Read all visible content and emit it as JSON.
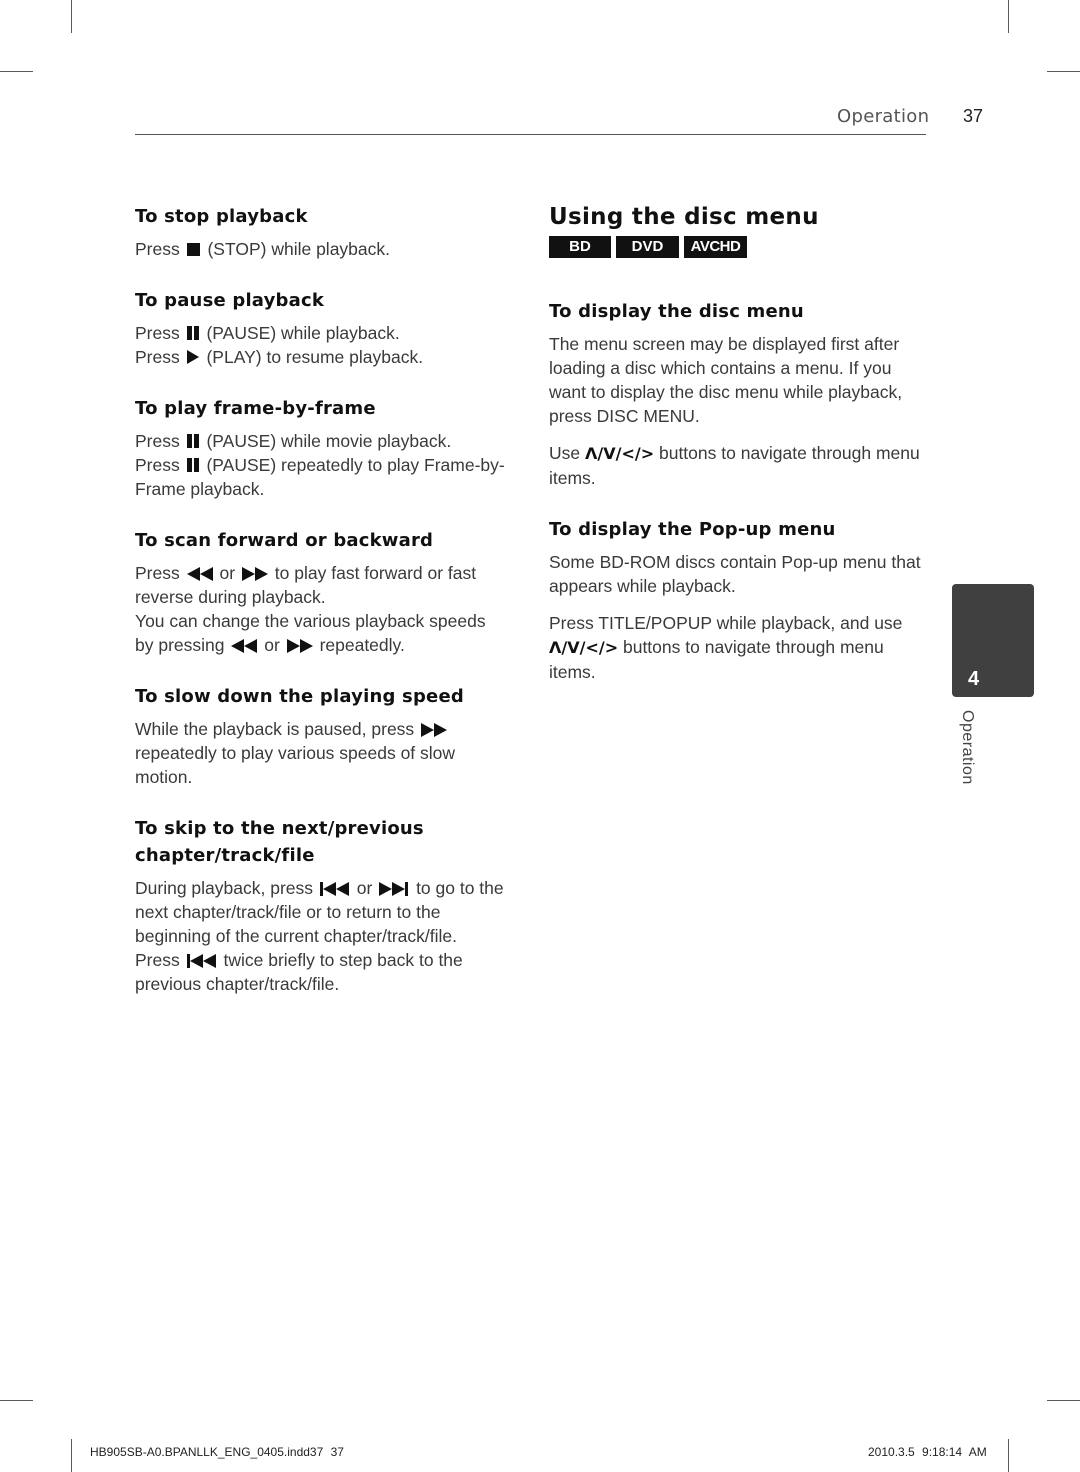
{
  "header": {
    "section": "Operation",
    "page_number": "37"
  },
  "left_column": {
    "stop": {
      "title": "To stop playback",
      "lines": [
        {
          "pre": "Press",
          "icon": "stop-icon",
          "post": "(STOP) while playback."
        }
      ]
    },
    "pause": {
      "title": "To pause playback",
      "lines": [
        {
          "pre": "Press",
          "icon": "pause-icon",
          "post": "(PAUSE) while playback."
        },
        {
          "pre": "Press",
          "icon": "play-icon",
          "post": "(PLAY) to resume playback."
        }
      ]
    },
    "frame": {
      "title": "To play frame-by-frame",
      "lines": [
        {
          "pre": "Press",
          "icon": "pause-icon",
          "post": "(PAUSE) while movie playback."
        },
        {
          "pre": "Press",
          "icon": "pause-icon",
          "post": "(PAUSE) repeatedly to play Frame-by-Frame playback."
        }
      ]
    },
    "scan": {
      "title": "To scan forward or backward",
      "p1": {
        "pre": "Press",
        "icon1": "rewind-icon",
        "mid": "or",
        "icon2": "fast-forward-icon",
        "post": "to play fast forward or fast reverse during playback."
      },
      "p2": {
        "pre": "You can change the various playback speeds by pressing",
        "icon1": "rewind-icon",
        "mid": "or",
        "icon2": "fast-forward-icon",
        "post": "repeatedly."
      }
    },
    "slow": {
      "title": "To slow down the playing speed",
      "p1": {
        "pre": "While the playback is paused, press",
        "icon": "fast-forward-icon",
        "post": "repeatedly to play various speeds of slow motion."
      }
    },
    "skip": {
      "title": "To skip to the next/previous chapter/track/file",
      "p1": {
        "pre": "During playback, press",
        "icon1": "skip-previous-icon",
        "mid": "or",
        "icon2": "skip-next-icon",
        "post": "to go to the next chapter/track/file or to return to the beginning of the current chapter/track/file."
      },
      "p2": {
        "pre": "Press",
        "icon": "skip-previous-icon",
        "post": "twice briefly to step back to the previous chapter/track/file."
      }
    }
  },
  "right_column": {
    "title": "Using the disc menu",
    "badges": [
      "BD",
      "DVD",
      "AVCHD"
    ],
    "disc_menu": {
      "title": "To display the disc menu",
      "p1": "The menu screen may be displayed first after loading a disc which contains a menu. If you want to display the disc menu while playback, press DISC MENU.",
      "p2": {
        "pre": "Use",
        "arrows": "Λ/V/</>",
        "post": "buttons to navigate through menu items."
      }
    },
    "popup_menu": {
      "title": "To display the Pop-up menu",
      "p1": "Some BD-ROM discs contain Pop-up menu that appears while playback.",
      "p2": {
        "pre": "Press TITLE/POPUP while playback, and use",
        "arrows": "Λ/V/</>",
        "post": "buttons to navigate through menu items."
      }
    }
  },
  "chapter_tab": {
    "number": "4",
    "label": "Operation"
  },
  "footer": {
    "file": "HB905SB-A0.BPANLLK_ENG_0405.indd37   37",
    "timestamp": "2010.3.5   9:18:14 AM"
  }
}
